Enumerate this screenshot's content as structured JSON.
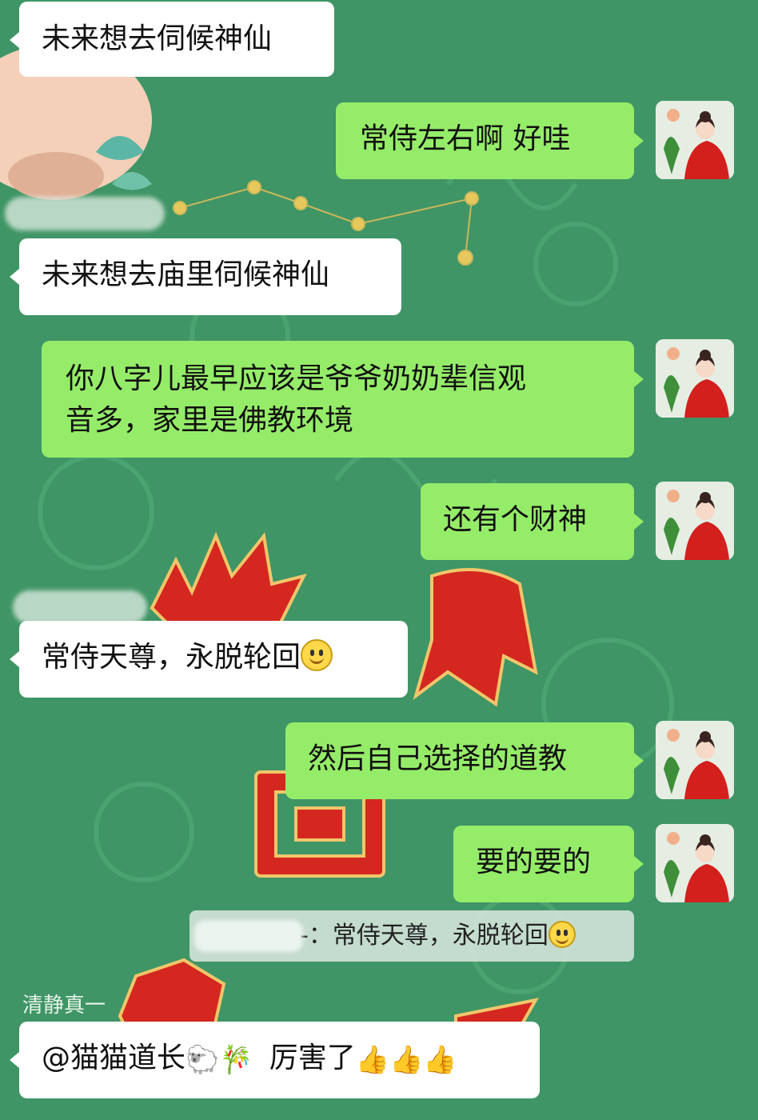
{
  "messages": [
    {
      "text": "未来想去伺候神仙"
    },
    {
      "text": "常侍左右啊  好哇"
    },
    {
      "text": "未来想去庙里伺候神仙"
    },
    {
      "line1": "你八字儿最早应该是爷爷奶奶辈信观",
      "line2": "音多，家里是佛教环境"
    },
    {
      "text": "还有个财神"
    },
    {
      "text": "常侍天尊，永脱轮回"
    },
    {
      "text": "然后自己选择的道教"
    },
    {
      "text": "要的要的"
    }
  ],
  "quote": {
    "text": "-：常侍天尊，永脱轮回"
  },
  "last": {
    "sender": "清静真一",
    "mention": "@猫猫道长",
    "emoji1": "🐑",
    "emoji2": "🎋",
    "text": "厉害了",
    "thumbs": "👍👍👍"
  },
  "icons": {
    "smile": "smiling-face-emoji",
    "avatar": "avatar-red-hanfu-woman"
  },
  "colors": {
    "background": "#3f9566",
    "outgoing": "#95ec69",
    "incoming": "#ffffff"
  }
}
